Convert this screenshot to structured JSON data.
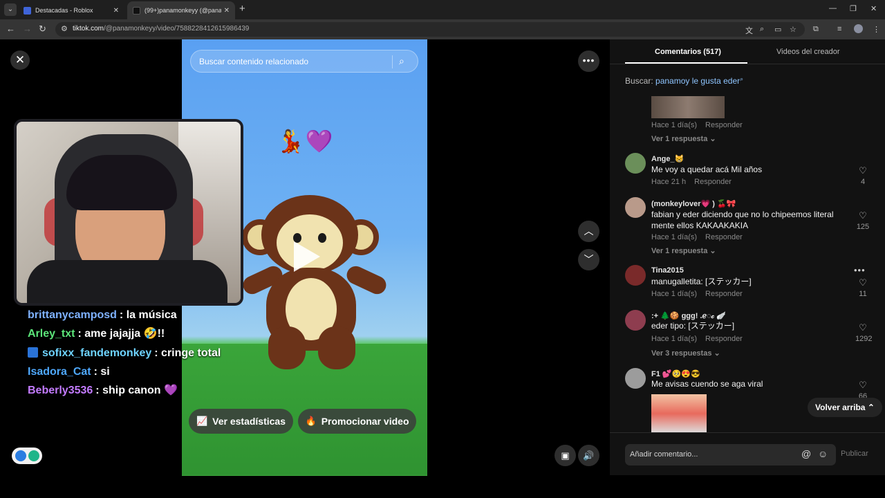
{
  "browser": {
    "tabs": [
      {
        "title": "Destacadas - Roblox",
        "favicon_color": "#3f64d8"
      },
      {
        "title": "(99+)panamonkeyy (@panamonkeyy)",
        "favicon_color": "#111111"
      }
    ],
    "url_host": "tiktok.com",
    "url_path": "/@panamonkeyy/video/7588228412615986439"
  },
  "video": {
    "search_placeholder": "Buscar contenido relacionado",
    "emoji_overlay": "💃💜",
    "chat": [
      {
        "user": "brittanycamposd",
        "text": ": la música",
        "color": "#7fb2ff"
      },
      {
        "user": "Arley_txt",
        "text": ": ame jajajja 🤣!!",
        "color": "#5ce67a"
      },
      {
        "user": "sofixx_fandemonkey",
        "text": ": cringe total",
        "color": "#6ed3ff"
      },
      {
        "user": "Isadora_Cat",
        "text": ": si",
        "color": "#4fa9ff"
      },
      {
        "user": "Beberly3536",
        "text": ": ship canon 💜",
        "color": "#c37bff"
      }
    ],
    "stats_button": "Ver estadísticas",
    "promote_button": "Promocionar video"
  },
  "panel": {
    "tab_comments": "Comentarios (517)",
    "tab_creator": "Videos del creador",
    "search_prefix": "Buscar:",
    "search_term": "panamoy le gusta eder",
    "reply_label": "Responder",
    "top_comment": {
      "time": "Hace 1 día(s)",
      "replies": "Ver 1 respuesta"
    },
    "comments": [
      {
        "user": "Ange_😸",
        "text": "Me voy a quedar acá Mil años",
        "time": "Hace 21 h",
        "likes": "4",
        "avatar": "#6b8f5a"
      },
      {
        "user": "(monkeylover💗 ) 🍒🎀",
        "text": "fabian y eder diciendo que no lo chipeemos literal mente ellos KAKAAKAKIA",
        "time": "Hace 1 día(s)",
        "likes": "125",
        "replies": "Ver 1 respuesta",
        "avatar": "#b99a8a"
      },
      {
        "user": "Tina2015",
        "text": "manugalletita: [ステッカー]",
        "time": "Hace 1 día(s)",
        "likes": "11",
        "avatar": "#7a2a2a"
      },
      {
        "user": ":+ 🌲🍪 ggg! .ℯ◌𝒸 🪽",
        "text": "eder tipo: [ステッカー]",
        "time": "Hace 1 día(s)",
        "likes": "1292",
        "replies": "Ver 3 respuestas",
        "avatar": "#8e3d4f"
      },
      {
        "user": "F1 💕🥺😍😎",
        "text": "Me avisas cuendo se aga viral",
        "likes": "66",
        "avatar": "#9c9c9c"
      }
    ],
    "back_to_top": "Volver arriba",
    "composer_placeholder": "Añadir comentario...",
    "publish": "Publicar"
  }
}
